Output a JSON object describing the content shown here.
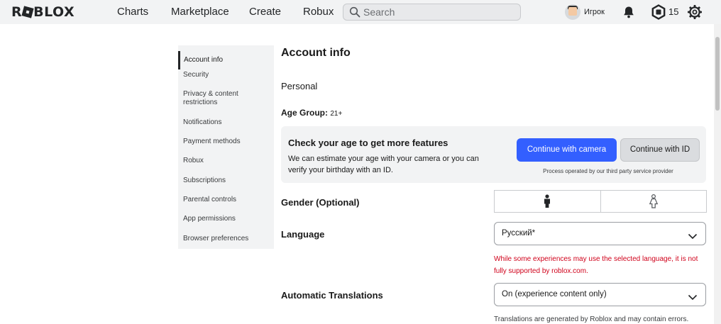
{
  "header": {
    "logo": "ROBLOX",
    "nav": [
      "Charts",
      "Marketplace",
      "Create",
      "Robux"
    ],
    "search_placeholder": "Search",
    "username": "Игрок",
    "robux_balance": "15",
    "icons": [
      "search-icon",
      "bell-icon",
      "robux-icon",
      "gear-icon"
    ]
  },
  "sidebar": {
    "items": [
      "Account info",
      "Security",
      "Privacy & content restrictions",
      "Notifications",
      "Payment methods",
      "Robux",
      "Subscriptions",
      "Parental controls",
      "App permissions",
      "Browser preferences"
    ],
    "active_index": 0
  },
  "main": {
    "title": "Account info",
    "section": "Personal",
    "age_group_label": "Age Group:",
    "age_group_value": "21+",
    "age_card": {
      "title": "Check your age to get more features",
      "description": "We can estimate your age with your camera or you can verify your birthday with an ID.",
      "camera_button": "Continue with camera",
      "id_button": "Continue with ID",
      "note": "Process operated by our third party service provider"
    },
    "gender_label": "Gender (Optional)",
    "gender_options": [
      "male-icon",
      "female-icon"
    ],
    "language_label": "Language",
    "language_value": "Русский*",
    "language_warning": "While some experiences may use the selected language, it is not fully supported by roblox.com.",
    "translations_label": "Automatic Translations",
    "translations_value": "On (experience content only)",
    "translations_note": "Translations are generated by Roblox and may contain errors."
  },
  "colors": {
    "primary_button": "#335fff",
    "warning_text": "#d0021b",
    "topbar_bg": "#f2f3f4"
  }
}
